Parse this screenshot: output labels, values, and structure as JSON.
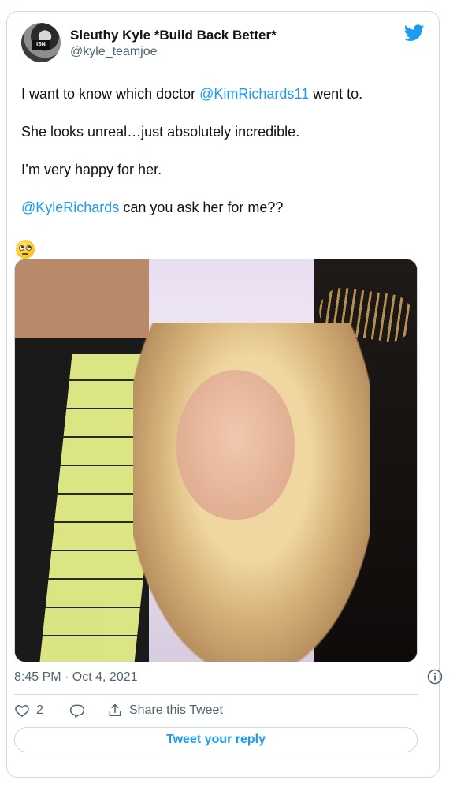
{
  "user": {
    "name": "Sleuthy Kyle *Build Back Better*",
    "handle": "@kyle_teamjoe"
  },
  "tweet": {
    "line1_pre": "I want to know which doctor ",
    "line1_mention": "@KimRichards11",
    "line1_post": " went to.",
    "line2": "She looks unreal…just absolutely incredible.",
    "line3": "I’m very happy for her.",
    "line4_mention": "@KyleRichards",
    "line4_post": " can you ask her for me??",
    "emoji": "face-with-rolling-eyes"
  },
  "meta": {
    "timestamp": "8:45 PM · Oct 4, 2021"
  },
  "actions": {
    "like_count": "2",
    "share_label": "Share this Tweet"
  },
  "reply": {
    "label": "Tweet your reply"
  },
  "colors": {
    "accent": "#1d9bf0",
    "text": "#0f1419",
    "secondary": "#536471",
    "border": "#cfd9de"
  },
  "icons": [
    "twitter-bird-icon",
    "info-icon",
    "heart-icon",
    "reply-bubble-icon",
    "share-icon"
  ]
}
